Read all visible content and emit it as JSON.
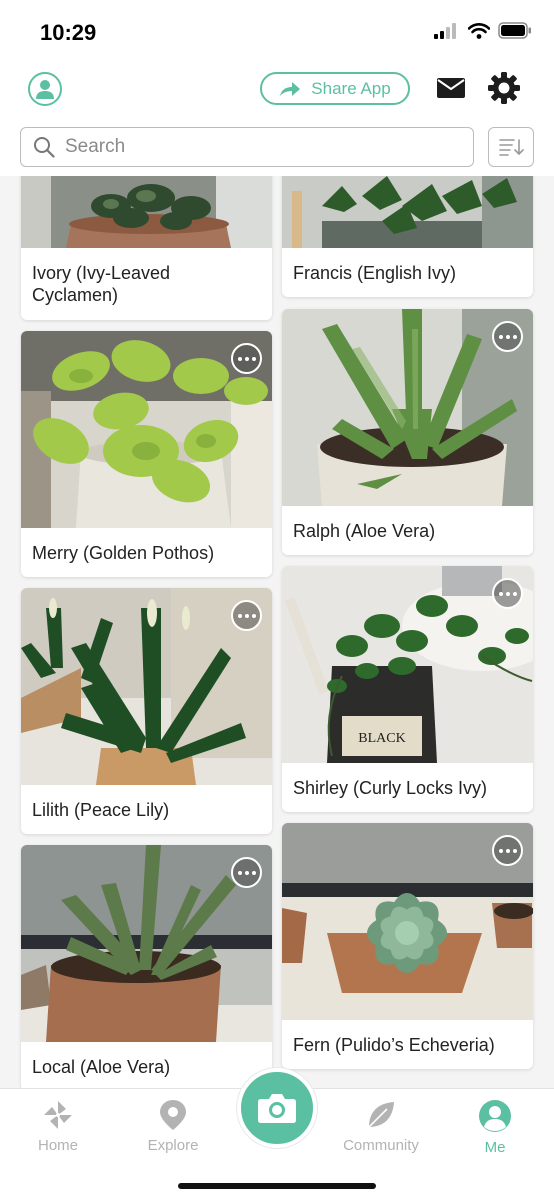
{
  "status": {
    "time": "10:29"
  },
  "header": {
    "share_label": "Share App"
  },
  "search": {
    "placeholder": "Search"
  },
  "plants": [
    {
      "name": "Ivory (Ivy-Leaved Cyclamen)"
    },
    {
      "name": "Francis (English Ivy)"
    },
    {
      "name": "Merry (Golden Pothos)"
    },
    {
      "name": "Ralph (Aloe Vera)"
    },
    {
      "name": "Lilith (Peace Lily)"
    },
    {
      "name": "Shirley (Curly Locks Ivy)"
    },
    {
      "name": "Local (Aloe Vera)"
    },
    {
      "name": "Fern (Pulido’s Echeveria)"
    }
  ],
  "tabs": [
    {
      "label": "Home",
      "icon": "pinwheel-icon"
    },
    {
      "label": "Explore",
      "icon": "map-pin-icon"
    },
    {
      "label": "Community",
      "icon": "leaf-icon"
    },
    {
      "label": "Me",
      "icon": "profile-icon",
      "active": true
    }
  ],
  "colors": {
    "accent": "#5bbfa2",
    "inactive": "#b3b3b3"
  }
}
